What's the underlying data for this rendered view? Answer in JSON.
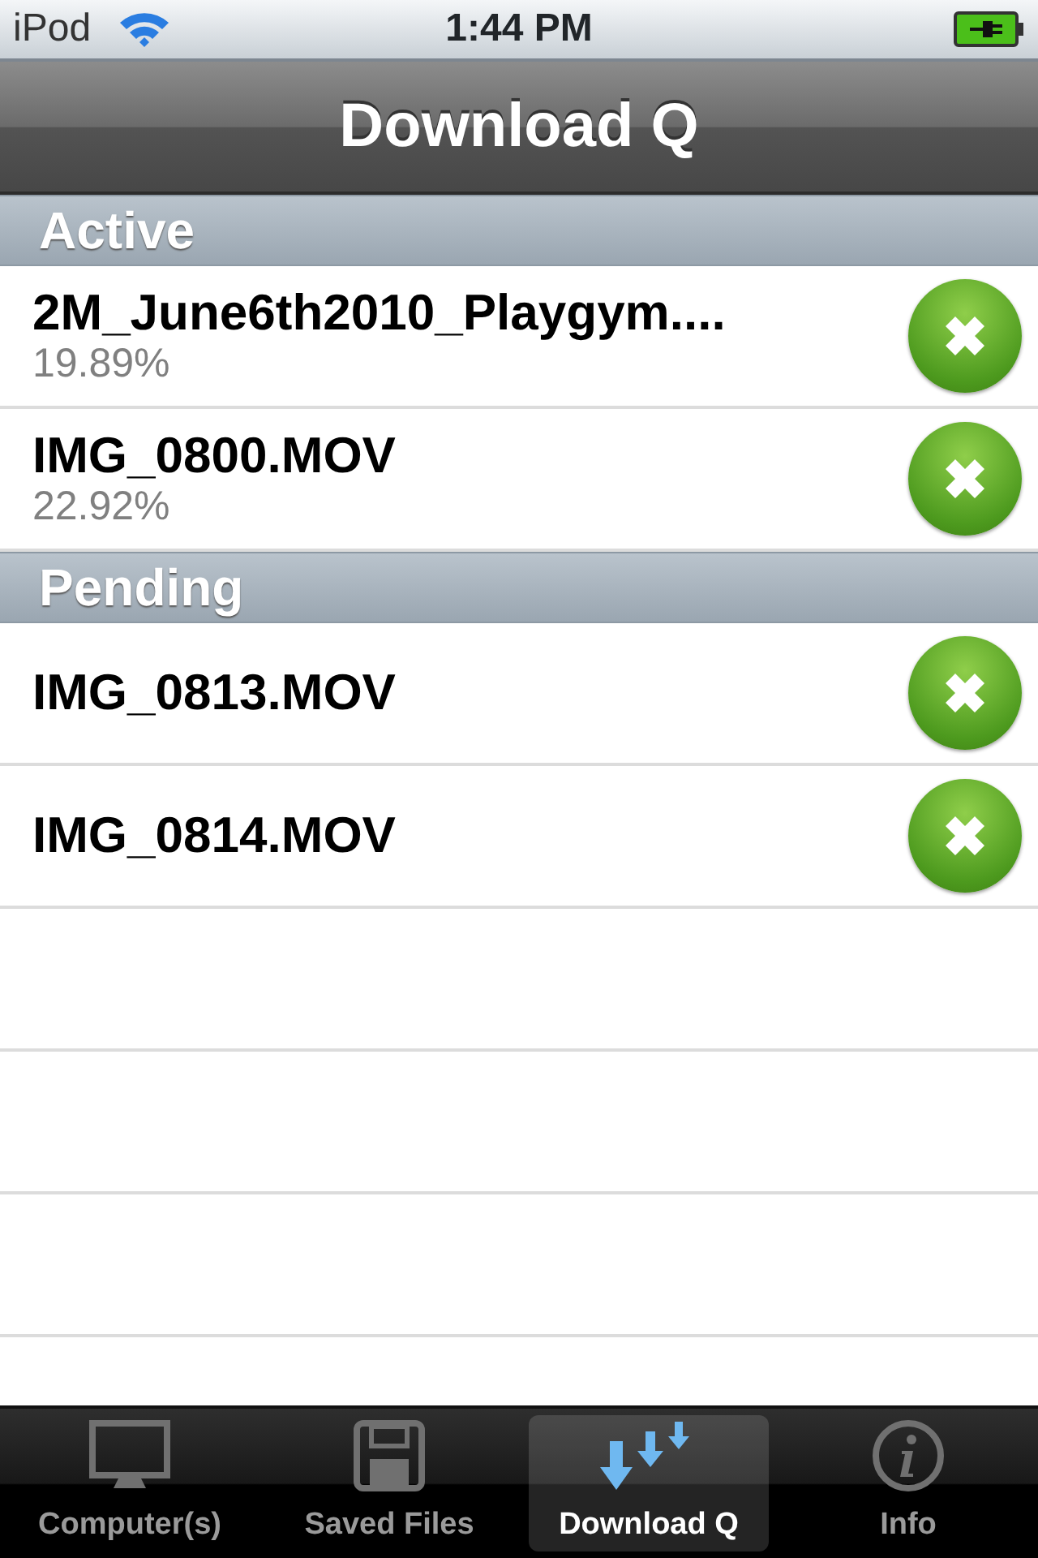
{
  "status_bar": {
    "carrier": "iPod",
    "time": "1:44 PM"
  },
  "nav_bar": {
    "title": "Download Q"
  },
  "sections": [
    {
      "title": "Active",
      "items": [
        {
          "name": "2M_June6th2010_Playgym....",
          "progress": "19.89%"
        },
        {
          "name": "IMG_0800.MOV",
          "progress": "22.92%"
        }
      ]
    },
    {
      "title": "Pending",
      "items": [
        {
          "name": "IMG_0813.MOV"
        },
        {
          "name": "IMG_0814.MOV"
        }
      ]
    }
  ],
  "tabs": [
    {
      "label": "Computer(s)",
      "kind": "monitor",
      "selected": false
    },
    {
      "label": "Saved Files",
      "kind": "floppy",
      "selected": false
    },
    {
      "label": "Download Q",
      "kind": "downloads",
      "selected": true
    },
    {
      "label": "Info",
      "kind": "info",
      "selected": false
    }
  ]
}
